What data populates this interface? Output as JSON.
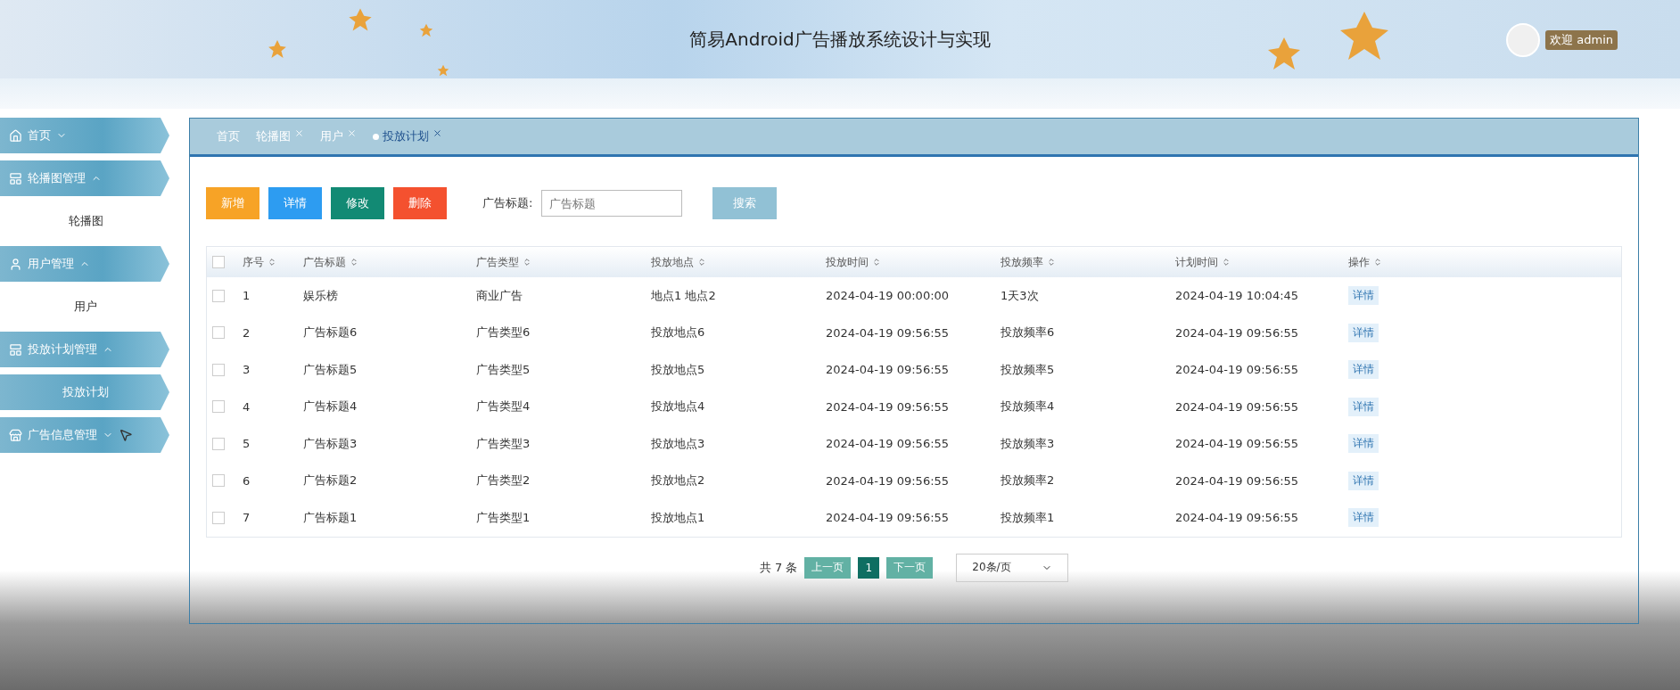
{
  "header": {
    "title": "简易Android广告播放系统设计与实现",
    "welcome": "欢迎 admin"
  },
  "sidebar": {
    "items": [
      {
        "label": "首页",
        "expanded": false,
        "selected": false
      },
      {
        "label": "轮播图管理",
        "expanded": true,
        "selected": false,
        "children": [
          {
            "label": "轮播图",
            "selected": false
          }
        ]
      },
      {
        "label": "用户管理",
        "expanded": true,
        "selected": false,
        "children": [
          {
            "label": "用户",
            "selected": false
          }
        ]
      },
      {
        "label": "投放计划管理",
        "expanded": true,
        "selected": false,
        "children": [
          {
            "label": "投放计划",
            "selected": true
          }
        ]
      },
      {
        "label": "广告信息管理",
        "expanded": false,
        "selected": false
      }
    ]
  },
  "tabs": [
    {
      "label": "首页",
      "closable": false,
      "selected": false
    },
    {
      "label": "轮播图",
      "closable": true,
      "selected": false
    },
    {
      "label": "用户",
      "closable": true,
      "selected": false
    },
    {
      "label": "投放计划",
      "closable": true,
      "selected": true
    }
  ],
  "toolbar": {
    "buttons": [
      {
        "label": "新增",
        "kind": "add"
      },
      {
        "label": "详情",
        "kind": "detail"
      },
      {
        "label": "修改",
        "kind": "edit"
      },
      {
        "label": "删除",
        "kind": "delete"
      }
    ],
    "search_label": "广告标题:",
    "search_placeholder": "广告标题",
    "search_button": "搜索"
  },
  "table": {
    "all_checked": false,
    "columns": [
      "序号",
      "广告标题",
      "广告类型",
      "投放地点",
      "投放时间",
      "投放频率",
      "计划时间",
      "操作"
    ],
    "rows": [
      {
        "checked": false,
        "cells": [
          "1",
          "娱乐榜",
          "商业广告",
          "地点1 地点2",
          "2024-04-19 00:00:00",
          "1天3次",
          "2024-04-19 10:04:45"
        ],
        "action": "详情"
      },
      {
        "checked": false,
        "cells": [
          "2",
          "广告标题6",
          "广告类型6",
          "投放地点6",
          "2024-04-19 09:56:55",
          "投放频率6",
          "2024-04-19 09:56:55"
        ],
        "action": "详情"
      },
      {
        "checked": false,
        "cells": [
          "3",
          "广告标题5",
          "广告类型5",
          "投放地点5",
          "2024-04-19 09:56:55",
          "投放频率5",
          "2024-04-19 09:56:55"
        ],
        "action": "详情"
      },
      {
        "checked": false,
        "cells": [
          "4",
          "广告标题4",
          "广告类型4",
          "投放地点4",
          "2024-04-19 09:56:55",
          "投放频率4",
          "2024-04-19 09:56:55"
        ],
        "action": "详情"
      },
      {
        "checked": false,
        "cells": [
          "5",
          "广告标题3",
          "广告类型3",
          "投放地点3",
          "2024-04-19 09:56:55",
          "投放频率3",
          "2024-04-19 09:56:55"
        ],
        "action": "详情"
      },
      {
        "checked": false,
        "cells": [
          "6",
          "广告标题2",
          "广告类型2",
          "投放地点2",
          "2024-04-19 09:56:55",
          "投放频率2",
          "2024-04-19 09:56:55"
        ],
        "action": "详情"
      },
      {
        "checked": false,
        "cells": [
          "7",
          "广告标题1",
          "广告类型1",
          "投放地点1",
          "2024-04-19 09:56:55",
          "投放频率1",
          "2024-04-19 09:56:55"
        ],
        "action": "详情"
      }
    ]
  },
  "pagination": {
    "total": "共 7 条",
    "prev": "上一页",
    "pages": [
      {
        "label": "1",
        "selected": true
      }
    ],
    "next": "下一页",
    "page_size": "20条/页"
  }
}
